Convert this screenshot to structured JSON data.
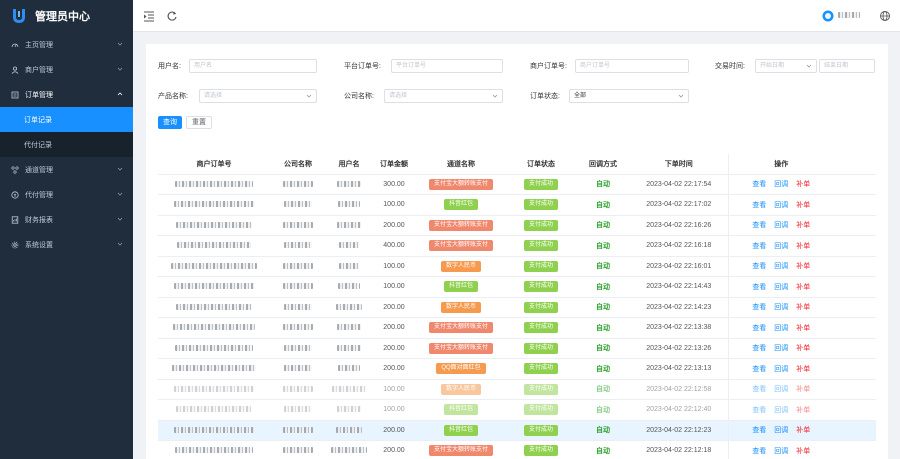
{
  "brand": {
    "title": "管理员中心"
  },
  "sidebar": {
    "items": [
      {
        "label": "主页管理",
        "icon": "gauge-icon"
      },
      {
        "label": "商户管理",
        "icon": "user-icon"
      },
      {
        "label": "订单管理",
        "icon": "order-icon",
        "open": true,
        "children": [
          {
            "label": "订单记录",
            "active": true
          },
          {
            "label": "代付记录"
          }
        ]
      },
      {
        "label": "通道管理",
        "icon": "channel-icon"
      },
      {
        "label": "代付管理",
        "icon": "payout-icon"
      },
      {
        "label": "财务报表",
        "icon": "report-icon"
      },
      {
        "label": "系统设置",
        "icon": "settings-icon"
      }
    ]
  },
  "header": {
    "menu_toggle_icon": "indent-icon",
    "refresh_icon": "refresh-icon",
    "avatar_icon": "avatar-icon",
    "language_icon": "globe-icon"
  },
  "filters": {
    "username_label": "用户名:",
    "username_placeholder": "用户名",
    "platform_order_label": "平台订单号:",
    "platform_order_placeholder": "平台订单号",
    "merchant_order_label": "商户订单号:",
    "merchant_order_placeholder": "商户订单号",
    "trade_time_label": "交易时间:",
    "start_date_placeholder": "开始日期",
    "end_date_placeholder": "结束日期",
    "product_label": "产品名称:",
    "product_placeholder": "请选择",
    "company_label": "公司名称:",
    "company_placeholder": "请选择",
    "status_label": "订单状态:",
    "status_value": "全部",
    "search_label": "查询",
    "reset_label": "重置"
  },
  "table": {
    "columns": [
      "商户订单号",
      "公司名称",
      "用户名",
      "订单金额",
      "通道名称",
      "订单状态",
      "回调方式",
      "下单时间",
      "操作"
    ],
    "actions": {
      "view": "查看",
      "callback": "回调",
      "fix": "补单"
    },
    "status_text": "支付成功",
    "callback_text": "自动",
    "rows": [
      {
        "amount": "300.00",
        "channel": "支付宝大额转账支付",
        "ccolor": "#f0886e",
        "time": "2023-04-02 22:17:54"
      },
      {
        "amount": "100.00",
        "channel": "抖音红包",
        "ccolor": "#8fd14f",
        "time": "2023-04-02 22:17:02"
      },
      {
        "amount": "200.00",
        "channel": "支付宝大额转账支付",
        "ccolor": "#f0886e",
        "time": "2023-04-02 22:16:26"
      },
      {
        "amount": "400.00",
        "channel": "支付宝大额转账支付",
        "ccolor": "#f0886e",
        "time": "2023-04-02 22:16:18"
      },
      {
        "amount": "100.00",
        "channel": "数字人民币",
        "ccolor": "#f59a4e",
        "time": "2023-04-02 22:16:01"
      },
      {
        "amount": "100.00",
        "channel": "抖音红包",
        "ccolor": "#8fd14f",
        "time": "2023-04-02 22:14:43"
      },
      {
        "amount": "200.00",
        "channel": "数字人民币",
        "ccolor": "#f59a4e",
        "time": "2023-04-02 22:14:23"
      },
      {
        "amount": "200.00",
        "channel": "支付宝大额转账支付",
        "ccolor": "#f0886e",
        "time": "2023-04-02 22:13:38"
      },
      {
        "amount": "200.00",
        "channel": "支付宝大额转账支付",
        "ccolor": "#f0886e",
        "time": "2023-04-02 22:13:26"
      },
      {
        "amount": "200.00",
        "channel": "QQ面对面红包",
        "ccolor": "#f59a4e",
        "time": "2023-04-02 22:13:13"
      },
      {
        "amount": "100.00",
        "channel": "数字人民币",
        "ccolor": "#f59a4e",
        "time": "2023-04-02 22:12:58",
        "faded": true
      },
      {
        "amount": "100.00",
        "channel": "抖音红包",
        "ccolor": "#8fd14f",
        "time": "2023-04-02 22:12:40",
        "faded": true
      },
      {
        "amount": "200.00",
        "channel": "抖音红包",
        "ccolor": "#8fd14f",
        "time": "2023-04-02 22:12:23",
        "highlight": true
      },
      {
        "amount": "200.00",
        "channel": "支付宝大额转账支付",
        "ccolor": "#f0886e",
        "time": "2023-04-02 22:12:18"
      }
    ]
  },
  "colors": {
    "accent": "#1890ff",
    "sidebar_bg": "#1f2d3d",
    "status_green": "#8fd14f",
    "fix_red": "#f5222d"
  }
}
